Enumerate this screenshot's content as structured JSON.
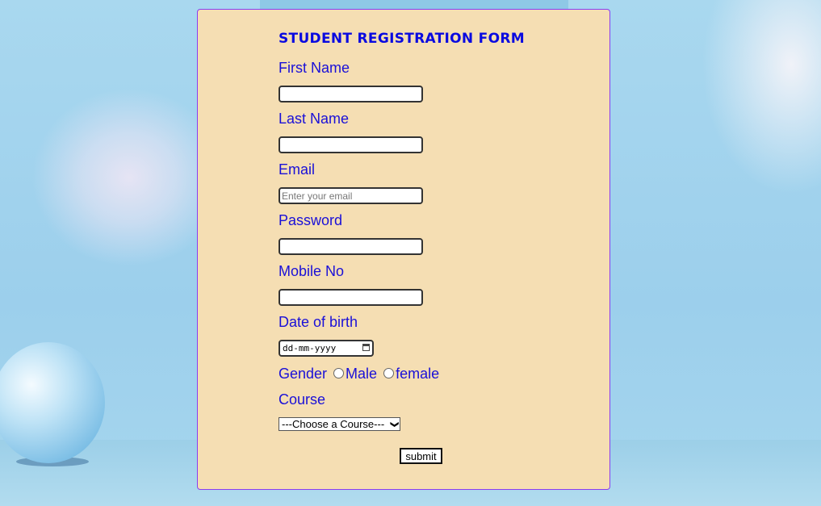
{
  "form": {
    "title": "Student Registration Form",
    "fields": [
      {
        "label": "First Name",
        "value": "",
        "placeholder": ""
      },
      {
        "label": "Last Name",
        "value": "",
        "placeholder": ""
      },
      {
        "label": "Email",
        "value": "",
        "placeholder": "Enter your email"
      },
      {
        "label": "Password",
        "value": "",
        "placeholder": ""
      },
      {
        "label": "Mobile No",
        "value": "",
        "placeholder": ""
      }
    ],
    "dob": {
      "label": "Date of birth",
      "placeholder": "dd-mm-yyyy"
    },
    "gender": {
      "label": "Gender",
      "options": [
        "Male",
        "female"
      ]
    },
    "course": {
      "label": "Course",
      "selected": "---Choose a Course---"
    },
    "submit_label": "submit"
  }
}
